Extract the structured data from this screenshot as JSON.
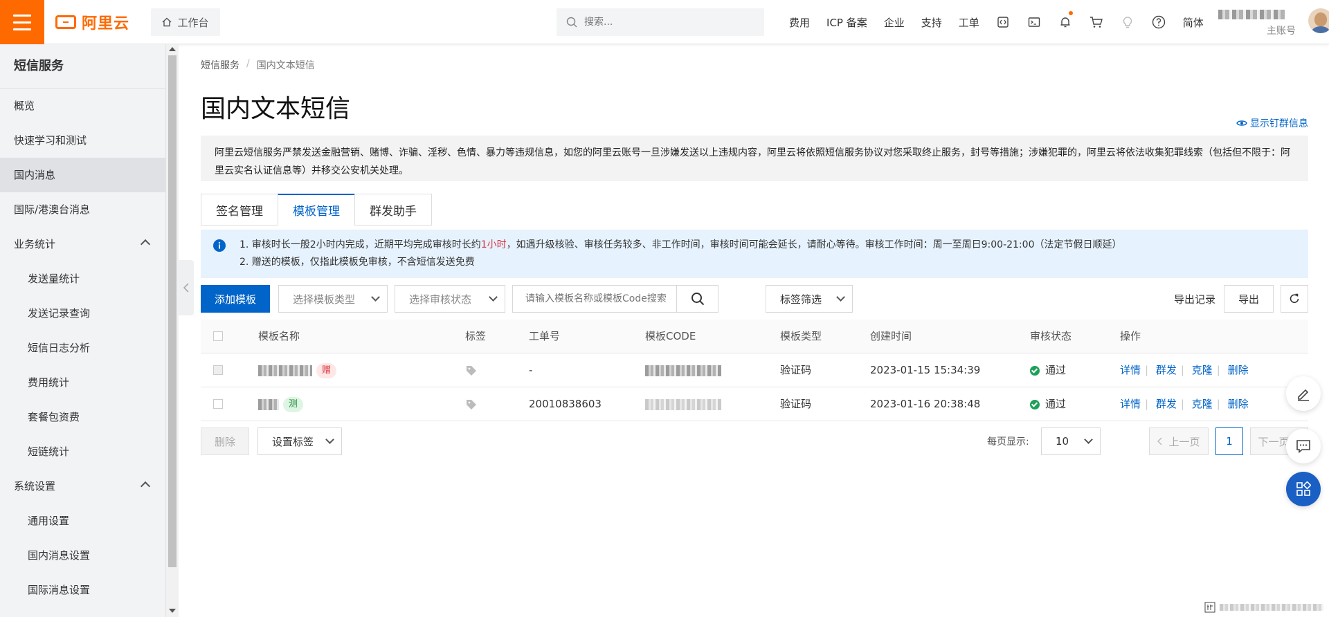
{
  "topbar": {
    "logo": "阿里云",
    "workbench": "工作台",
    "search_placeholder": "搜索...",
    "nav": [
      "费用",
      "ICP 备案",
      "企业",
      "支持",
      "工单"
    ],
    "lang": "简体",
    "account_sub": "主账号",
    "icons": [
      "code-icon",
      "terminal-icon",
      "bell-icon",
      "cart-icon",
      "bulb-icon",
      "help-icon"
    ]
  },
  "sidebar": {
    "title": "短信服务",
    "items": [
      {
        "label": "概览",
        "type": "top"
      },
      {
        "label": "快速学习和测试",
        "type": "top"
      },
      {
        "label": "国内消息",
        "type": "top",
        "active": true
      },
      {
        "label": "国际/港澳台消息",
        "type": "top"
      },
      {
        "label": "业务统计",
        "type": "group"
      },
      {
        "label": "发送量统计",
        "type": "sub"
      },
      {
        "label": "发送记录查询",
        "type": "sub"
      },
      {
        "label": "短信日志分析",
        "type": "sub"
      },
      {
        "label": "费用统计",
        "type": "sub"
      },
      {
        "label": "套餐包资费",
        "type": "sub"
      },
      {
        "label": "短链统计",
        "type": "sub"
      },
      {
        "label": "系统设置",
        "type": "group"
      },
      {
        "label": "通用设置",
        "type": "sub"
      },
      {
        "label": "国内消息设置",
        "type": "sub"
      },
      {
        "label": "国际消息设置",
        "type": "sub"
      }
    ]
  },
  "breadcrumb": {
    "root": "短信服务",
    "sep": "/",
    "current": "国内文本短信"
  },
  "page_title": "国内文本短信",
  "show_group": "显示钉群信息",
  "warning_text": "阿里云短信服务严禁发送金融营销、赌博、诈骗、淫秽、色情、暴力等违规信息，如您的阿里云账号一旦涉嫌发送以上违规内容，阿里云将依照短信服务协议对您采取终止服务，封号等措施；涉嫌犯罪的，阿里云将依法收集犯罪线索（包括但不限于：阿里云实名认证信息等）并移交公安机关处理。",
  "tabs": [
    "签名管理",
    "模板管理",
    "群发助手"
  ],
  "notice": {
    "line1_a": "1. 审核时长一般2小时内完成，近期平均完成审核时长约",
    "line1_red": "1小时",
    "line1_b": "，如遇升级核验、审核任务较多、非工作时间，审核时间可能会延长，请耐心等待。审核工作时间：周一至周日9:00-21:00（法定节假日顺延）",
    "line2": "2. 赠送的模板，仅指此模板免审核，不含短信发送免费"
  },
  "toolbar": {
    "add": "添加模板",
    "type_select": "选择模板类型",
    "status_select": "选择审核状态",
    "search_placeholder": "请输入模板名称或模板Code搜索",
    "tag_filter": "标签筛选",
    "export_records": "导出记录",
    "export": "导出"
  },
  "table": {
    "headers": [
      "模板名称",
      "标签",
      "工单号",
      "模板CODE",
      "模板类型",
      "创建时间",
      "审核状态",
      "操作"
    ],
    "rows": [
      {
        "name_tag": "赠",
        "ticket": "-",
        "type": "验证码",
        "created": "2023-01-15 15:34:39",
        "status": "通过"
      },
      {
        "name_tag": "测",
        "ticket": "20010838603",
        "type": "验证码",
        "created": "2023-01-16 20:38:48",
        "status": "通过"
      }
    ],
    "ops": [
      "详情",
      "群发",
      "克隆",
      "删除"
    ]
  },
  "bottom": {
    "delete": "删除",
    "set_tag": "设置标签",
    "per_page_label": "每页显示:",
    "per_page": "10",
    "prev": "上一页",
    "page": "1",
    "next": "下一页"
  },
  "colors": {
    "brand": "#ff6a00",
    "primary": "#0064c8",
    "danger": "#d9333e",
    "success": "#1ea05a"
  }
}
